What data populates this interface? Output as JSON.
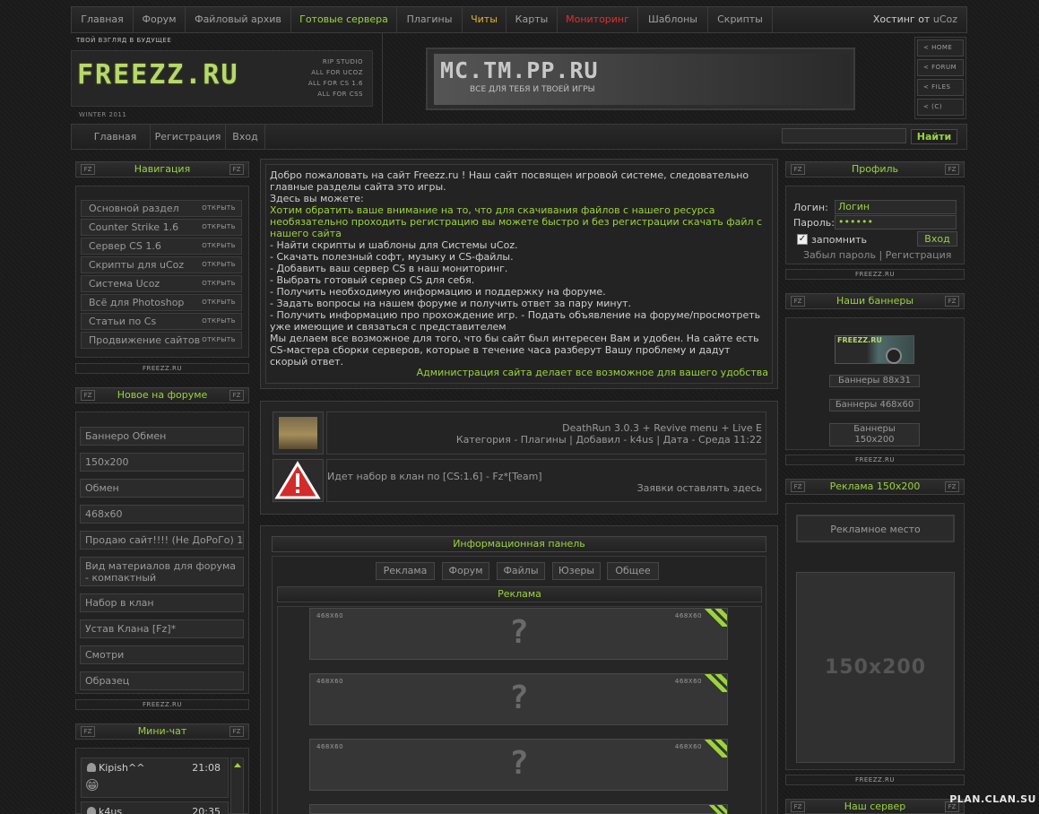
{
  "topmenu": {
    "items": [
      "Главная",
      "Форум",
      "Файловый архив",
      "Готовые сервера",
      "Плагины",
      "Читы",
      "Карты",
      "Мониторинг",
      "Шаблоны",
      "Скрипты"
    ],
    "hosting_prefix": "Хостинг от ",
    "hosting_brand": "uCoz"
  },
  "header": {
    "slogan": "ТВОЙ ВЗГЛЯД В БУДУЩЕЕ",
    "logo": "FREEZZ.RU",
    "logo_sub": [
      "RIP STUDIO",
      "ALL FOR UCOZ",
      "ALL FOR CS 1.6",
      "ALL FOR CSS"
    ],
    "season": "WINTER 2011",
    "banner_title": "MC.TM.PP.RU",
    "banner_sub": "ВСЕ ДЛЯ ТЕБЯ И ТВОЕЙ ИГРЫ",
    "quick_links": [
      "HOME",
      "FORUM",
      "FILES",
      "(C)"
    ]
  },
  "menu2": {
    "items": [
      "Главная",
      "Регистрация",
      "Вход"
    ],
    "search_button": "Найти",
    "search_value": ""
  },
  "left": {
    "nav_title": "Навигация",
    "fz": "FZ",
    "footer": "FREEZZ.RU",
    "open_label": "ОТКРЫТЬ",
    "nav_items": [
      "Основной раздел",
      "Counter Strike 1.6",
      "Сервер CS 1.6",
      "Скрипты для uCoz",
      "Система Ucoz",
      "Всё для Photoshop",
      "Статьи по Cs",
      "Продвижение сайтов"
    ],
    "forum_title": "Новое на форуме",
    "forum_items": [
      "Баннеро Обмен",
      "150x200",
      "Обмен",
      "468x60",
      "Продаю сайт!!!! (Не ДоРоГо) 1",
      "Вид материалов для форума - компактный",
      "Набор в клан",
      "Устав Клана [Fz]*",
      "Смотри",
      "Образец"
    ],
    "chat_title": "Мини-чат",
    "chat": [
      {
        "user": "Kipish^^",
        "time": "21:08",
        "smile": "😁"
      },
      {
        "user": "k4us",
        "time": "20:35"
      }
    ]
  },
  "center": {
    "welcome_line1": "Добро пожаловать на сайт Freezz.ru ! Наш сайт посвящен игровой системе, следовательно главные разделы сайта это игры.",
    "welcome_line2": "Здесь вы можете:",
    "welcome_green": "Хотим обратить ваше внимание на то, что для скачивания файлов с нашего ресурса необязательно проходить регистрацию вы можете быстро и без регистрации скачать файл с нашего сайта",
    "welcome_list": [
      "- Найти скрипты и шаблоны для Системы uCoz.",
      "- Скачать полезный софт, музыку и CS-файлы.",
      "- Добавить ваш сервер CS в наш мониторинг.",
      "- Выбрать готовый сервер CS для себя.",
      "- Получить необходимую информацию и поддержку на форуме.",
      "- Задать вопросы на нашем форуме и получить ответ за пару минут.",
      "- Получить информацию про прохождение игр. - Подать объявление на форуме/просмотреть уже имеющие и связаться с представителем"
    ],
    "welcome_end": "Мы делаем все возможное для того, что бы сайт был интересен Вам и удобен. На сайте есть CS-мастера сборки серверов, которые в течение часа разберут Вашу проблему и дадут скорый ответ.",
    "welcome_admin": "Администрация сайта делает все возможное для вашего удобства",
    "news": [
      {
        "title": "DeathRun 3.0.3 + Revive menu + Live E",
        "meta": "Категория - Плагины | Добавил - k4us | Дата - Среда 11:22"
      },
      {
        "title": "Идет набор в клан по [CS:1.6] - Fz*[Team]",
        "meta": "Заявки оставлять здесь"
      }
    ],
    "info_title": "Информационная панель",
    "tabs": [
      "Реклама",
      "Форум",
      "Файлы",
      "Юзеры",
      "Общее"
    ],
    "ads_title": "Реклама",
    "ad_label": "468X60",
    "ad_q": "?"
  },
  "right": {
    "profile_title": "Профиль",
    "login_label": "Логин:",
    "login_value": "Логин",
    "password_label": "Пароль:",
    "password_value": "••••••",
    "remember": "запомнить",
    "login_button": "Вход",
    "forgot": "Забыл пароль",
    "register": "Регистрация",
    "banners_title": "Наши баннеры",
    "banner_logo": "FREEZZ.RU",
    "banner_buttons": [
      "Баннеры 88x31",
      "Баннеры 468x60",
      "Баннеры 150x200"
    ],
    "ads_title": "Реклама 150x200",
    "ads_place": "Рекламное место",
    "ads_size": "150x200",
    "server_title": "Наш сервер"
  },
  "watermark": "PLAN.CLAN.SU",
  "colors": {
    "accent": "#9bd43a",
    "background": "#1b1b1b",
    "red": "#e03030",
    "orange": "#e8b030"
  }
}
